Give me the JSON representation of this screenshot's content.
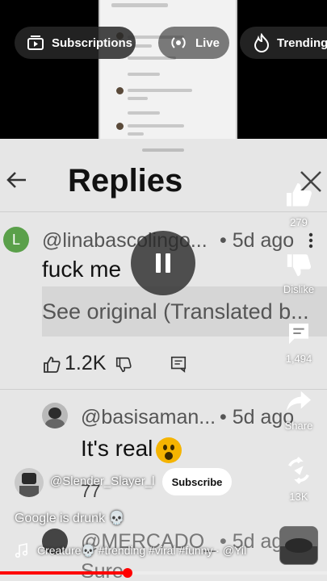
{
  "top_chips": [
    {
      "label": "Subscriptions"
    },
    {
      "label": "Live"
    },
    {
      "label": "Trending"
    }
  ],
  "replies_panel": {
    "title": "Replies",
    "comments": [
      {
        "avatar_letter": "L",
        "handle": "@linabascolingo...",
        "ago": "• 5d ago",
        "text": "fuck me",
        "translate_label": "See original (Translated b...",
        "likes": "1.2K"
      },
      {
        "handle": "@basisaman...",
        "ago": "• 5d ago",
        "text": "It's real",
        "likes": "77"
      },
      {
        "handle": "@MERCADO_",
        "ago": "• 5d ago",
        "text": "Sure"
      }
    ]
  },
  "rail": {
    "like_count": "279",
    "dislike_label": "Dislike",
    "comment_count": "1,494",
    "share_label": "Share",
    "remix_count": "13K"
  },
  "channel": {
    "name": "@Slender_Slayer_l",
    "subscribe_label": "Subscribe"
  },
  "caption": "Google is drunk 💀",
  "music": "Creature💀 #trending #viral #funny · @Yil",
  "progress": {
    "fraction": 0.39
  },
  "colors": {
    "progress": "#ff0000",
    "avatar_green": "#5aa04a"
  }
}
